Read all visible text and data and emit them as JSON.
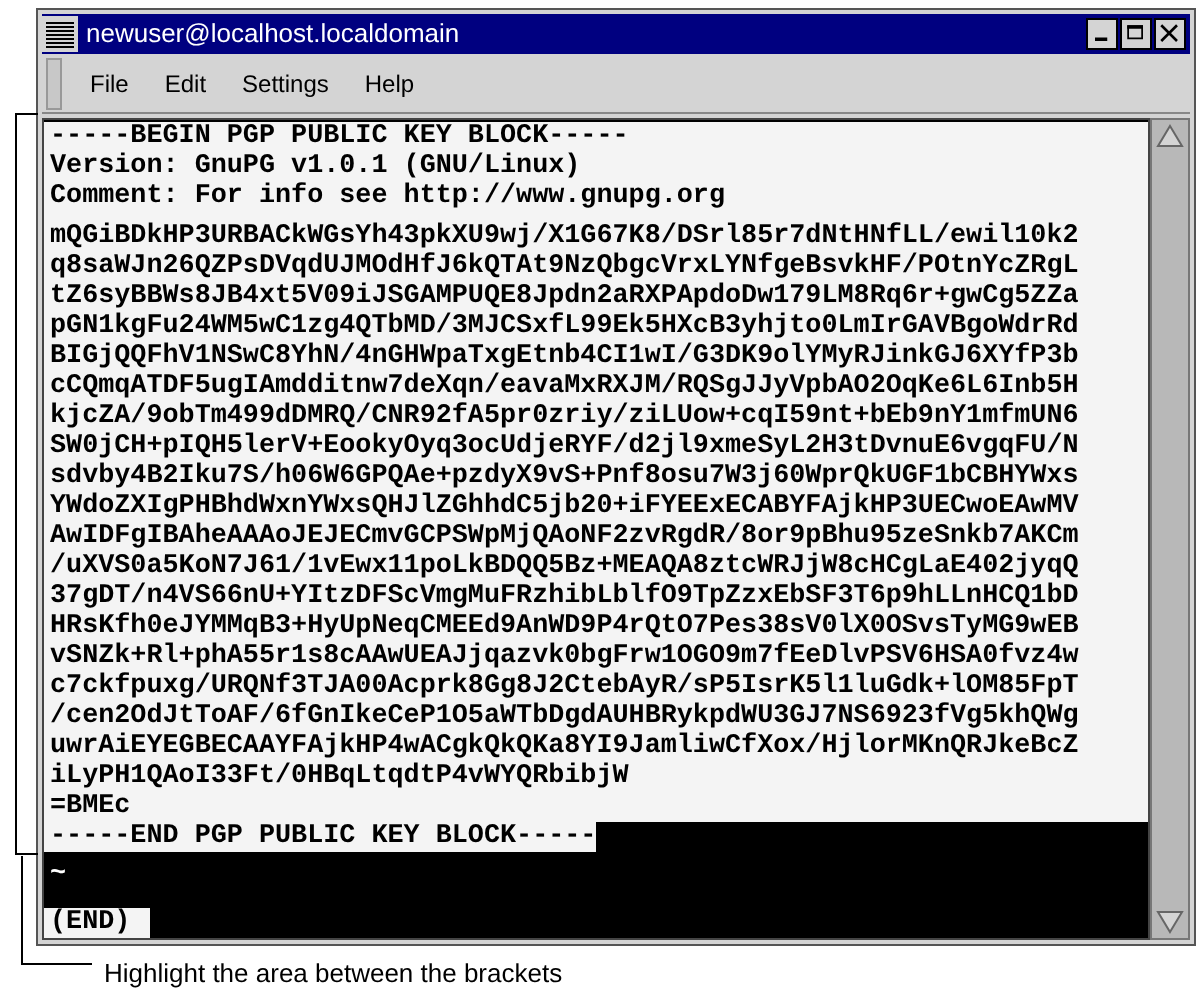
{
  "window": {
    "title": "newuser@localhost.localdomain"
  },
  "menu": [
    "File",
    "Edit",
    "Settings",
    "Help"
  ],
  "terminal": {
    "blocks": [
      {
        "selected": true,
        "lines": [
          "-----BEGIN PGP PUBLIC KEY BLOCK-----",
          "Version: GnuPG v1.0.1 (GNU/Linux)",
          "Comment: For info see http://www.gnupg.org"
        ]
      },
      {
        "selected": true,
        "lines": [
          "mQGiBDkHP3URBACkWGsYh43pkXU9wj/X1G67K8/DSrl85r7dNtHNfLL/ewil10k2",
          "q8saWJn26QZPsDVqdUJMOdHfJ6kQTAt9NzQbgcVrxLYNfgeBsvkHF/POtnYcZRgL",
          "tZ6syBBWs8JB4xt5V09iJSGAMPUQE8Jpdn2aRXPApdoDw179LM8Rq6r+gwCg5ZZa",
          "pGN1kgFu24WM5wC1zg4QTbMD/3MJCSxfL99Ek5HXcB3yhjto0LmIrGAVBgoWdrRd",
          "BIGjQQFhV1NSwC8YhN/4nGHWpaTxgEtnb4CI1wI/G3DK9olYMyRJinkGJ6XYfP3b",
          "cCQmqATDF5ugIAmdditnw7deXqn/eavaMxRXJM/RQSgJJyVpbAO2OqKe6L6Inb5H",
          "kjcZA/9obTm499dDMRQ/CNR92fA5pr0zriy/ziLUow+cqI59nt+bEb9nY1mfmUN6",
          "SW0jCH+pIQH5lerV+EookyOyq3ocUdjeRYF/d2jl9xmeSyL2H3tDvnuE6vgqFU/N",
          "sdvby4B2Iku7S/h06W6GPQAe+pzdyX9vS+Pnf8osu7W3j60WprQkUGF1bCBHYWxs",
          "YWdoZXIgPHBhdWxnYWxsQHJlZGhhdC5jb20+iFYEExECABYFAjkHP3UECwoEAwMV",
          "AwIDFgIBAheAAAoJEJECmvGCPSWpMjQAoNF2zvRgdR/8or9pBhu95zeSnkb7AKCm",
          "/uXVS0a5KoN7J61/1vEwx11poLkBDQQ5Bz+MEAQA8ztcWRJjW8cHCgLaE402jyqQ",
          "37gDT/n4VS66nU+YItzDFScVmgMuFRzhibLblfO9TpZzxEbSF3T6p9hLLnHCQ1bD",
          "HRsKfh0eJYMMqB3+HyUpNeqCMEEd9AnWD9P4rQtO7Pes38sV0lX0OSvsTyMG9wEB",
          "vSNZk+Rl+phA55r1s8cAAwUEAJjqazvk0bgFrw1OGO9m7fEeDlvPSV6HSA0fvz4w",
          "c7ckfpuxg/URQNf3TJA00Acprk8Gg8J2CtebAyR/sP5IsrK5l1luGdk+lOM85FpT",
          "/cen2OdJtToAF/6fGnIkeCeP1O5aWTbDgdAUHBRykpdWU3GJ7NS6923fVg5khQWg",
          "uwrAiEYEGBECAAYFAjkHP4wACgkQkQKa8YI9JamliwCfXox/HjlorMKnQRJkeBcZ",
          "iLyPH1QAoI33Ft/0HBqLtqdtP4vWYQRbibjW",
          "=BMEc",
          "-----END PGP PUBLIC KEY BLOCK-----"
        ]
      },
      {
        "selected": false,
        "lines": [
          "~"
        ]
      }
    ],
    "status": "(END)"
  },
  "annotation": {
    "caption": "Highlight the area between the brackets"
  }
}
